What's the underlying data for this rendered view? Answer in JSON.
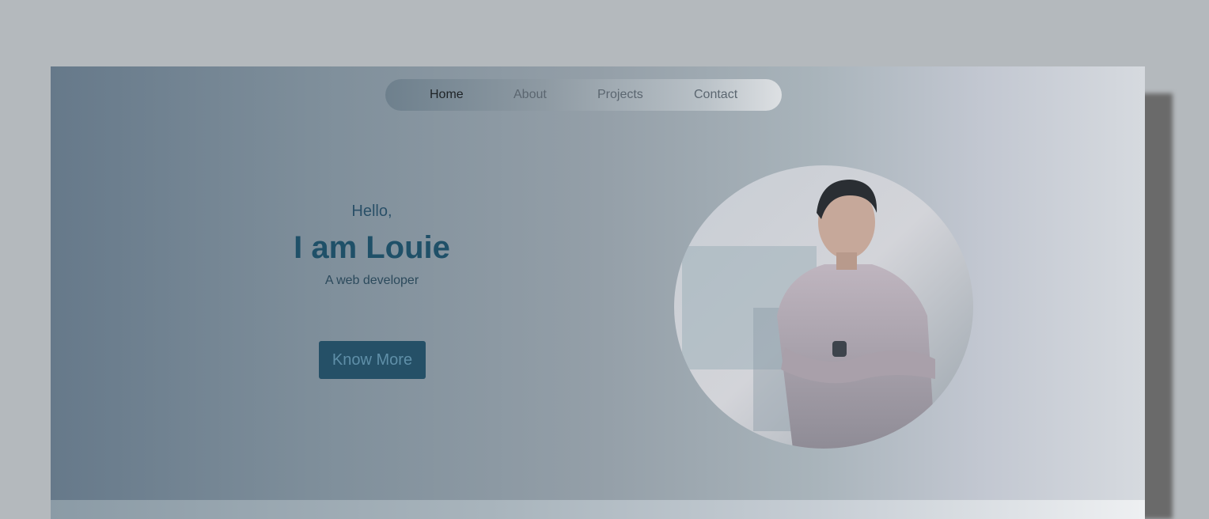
{
  "nav": {
    "items": [
      {
        "label": "Home",
        "active": true
      },
      {
        "label": "About",
        "active": false
      },
      {
        "label": "Projects",
        "active": false
      },
      {
        "label": "Contact",
        "active": false
      }
    ]
  },
  "hero": {
    "greeting": "Hello,",
    "name": "I am Louie",
    "role": "A web developer",
    "cta_label": "Know More"
  },
  "colors": {
    "accent": "#255067",
    "heading": "#1f5068"
  },
  "icons": {
    "profile": "profile-photo"
  }
}
